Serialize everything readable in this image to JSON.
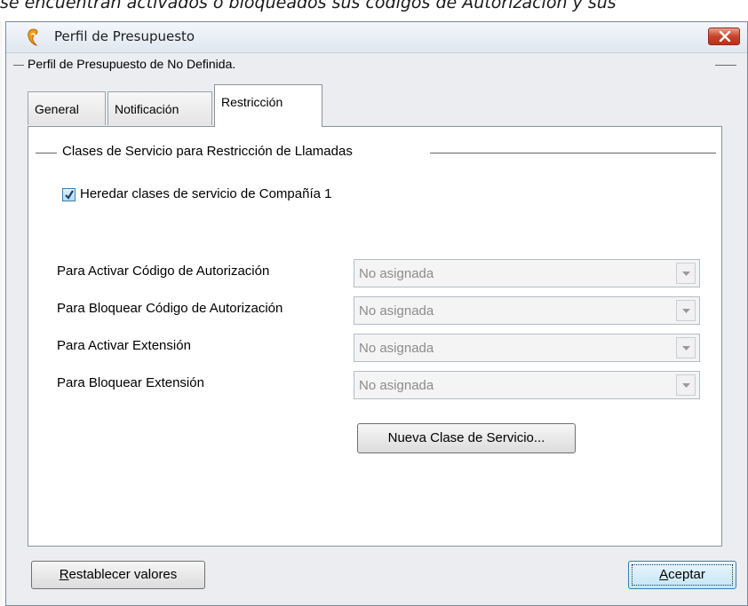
{
  "background_caption": "se encuentran activados o bloqueados sus códigos de Autorización y sus",
  "window": {
    "title": "Perfil de Presupuesto",
    "app_icon": "budget-app-icon",
    "close_icon": "close-icon"
  },
  "subheader": {
    "text": "Perfil de Presupuesto de No Definida."
  },
  "tabs": [
    {
      "label": "General",
      "active": false
    },
    {
      "label": "Notificación",
      "active": false
    },
    {
      "label": "Restricción",
      "active": true
    }
  ],
  "restriction": {
    "group_title": "Clases de Servicio para Restricción de Llamadas",
    "inherit_checkbox": {
      "label": "Heredar clases de servicio de Compañía 1",
      "checked": true
    },
    "fields": [
      {
        "label": "Para Activar Código de Autorización",
        "value": "No asignada"
      },
      {
        "label": "Para Bloquear Código de Autorización",
        "value": "No asignada"
      },
      {
        "label": "Para Activar Extensión",
        "value": "No asignada"
      },
      {
        "label": "Para Bloquear Extensión",
        "value": "No asignada"
      }
    ],
    "new_class_button": "Nueva Clase de Servicio..."
  },
  "footer": {
    "reset_button": "Restablecer valores",
    "ok_button": "Aceptar"
  },
  "colors": {
    "close_button": "#c7432a",
    "checkbox_accent": "#3c7fb1",
    "disabled_text": "#8c8c8c"
  }
}
